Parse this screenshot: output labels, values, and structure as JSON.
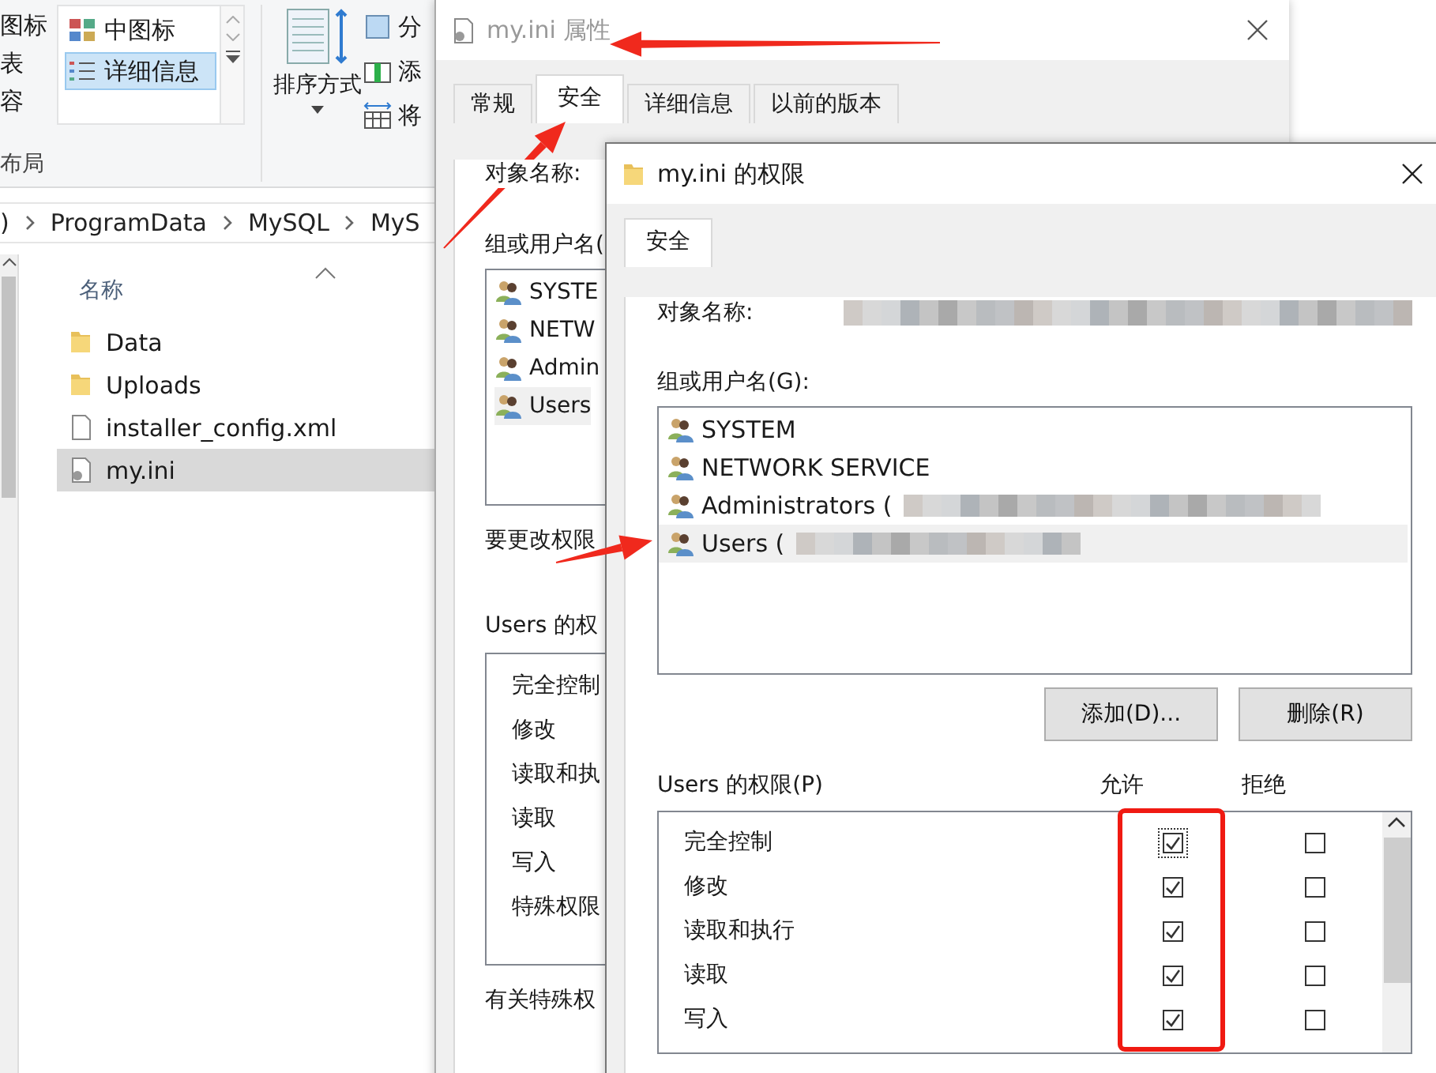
{
  "explorer": {
    "ribbon": {
      "layout_items": [
        "图标",
        "表",
        "容"
      ],
      "view_options": [
        {
          "label": "中图标",
          "selected": false
        },
        {
          "label": "详细信息",
          "selected": true
        }
      ],
      "group_label": "布局",
      "sort_button": "排序方式",
      "side_items": [
        "分",
        "添",
        "将"
      ]
    },
    "address": [
      ")",
      "ProgramData",
      "MySQL",
      "MyS"
    ],
    "column_header": "名称",
    "files": [
      {
        "name": "Data",
        "kind": "folder",
        "selected": false
      },
      {
        "name": "Uploads",
        "kind": "folder",
        "selected": false
      },
      {
        "name": "installer_config.xml",
        "kind": "file",
        "selected": false
      },
      {
        "name": "my.ini",
        "kind": "settings",
        "selected": true
      }
    ]
  },
  "properties": {
    "title": "my.ini 属性",
    "tabs": [
      {
        "label": "常规",
        "selected": false
      },
      {
        "label": "安全",
        "selected": true
      },
      {
        "label": "详细信息",
        "selected": false
      },
      {
        "label": "以前的版本",
        "selected": false
      }
    ],
    "object_label": "对象名称:",
    "group_label": "组或用户名(",
    "users": [
      {
        "name": "SYSTE",
        "selected": false
      },
      {
        "name": "NETW",
        "selected": false
      },
      {
        "name": "Admin",
        "selected": false
      },
      {
        "name": "Users",
        "selected": true
      }
    ],
    "change_note": "要更改权限",
    "perm_label": "Users 的权",
    "permissions": [
      "完全控制",
      "修改",
      "读取和执",
      "读取",
      "写入",
      "特殊权限"
    ],
    "special_note": "有关特殊权"
  },
  "permissions_dialog": {
    "title": "my.ini 的权限",
    "tabs": [
      {
        "label": "安全",
        "selected": true
      }
    ],
    "object_label": "对象名称:",
    "object_value_redacted": true,
    "group_label": "组或用户名(G):",
    "users": [
      {
        "name": "SYSTEM",
        "redacted": false,
        "selected": false
      },
      {
        "name": "NETWORK SERVICE",
        "redacted": false,
        "selected": false
      },
      {
        "name": "Administrators (",
        "redacted": true,
        "selected": false
      },
      {
        "name": "Users (",
        "redacted": true,
        "selected": true
      }
    ],
    "buttons": [
      "添加(D)...",
      "删除(R)"
    ],
    "perm_label": "Users 的权限(P)",
    "allow_header": "允许",
    "deny_header": "拒绝",
    "permissions": [
      {
        "name": "完全控制",
        "allow": true,
        "deny": false,
        "focused": true
      },
      {
        "name": "修改",
        "allow": true,
        "deny": false,
        "focused": false
      },
      {
        "name": "读取和执行",
        "allow": true,
        "deny": false,
        "focused": false
      },
      {
        "name": "读取",
        "allow": true,
        "deny": false,
        "focused": false
      },
      {
        "name": "写入",
        "allow": true,
        "deny": false,
        "focused": false
      }
    ]
  }
}
